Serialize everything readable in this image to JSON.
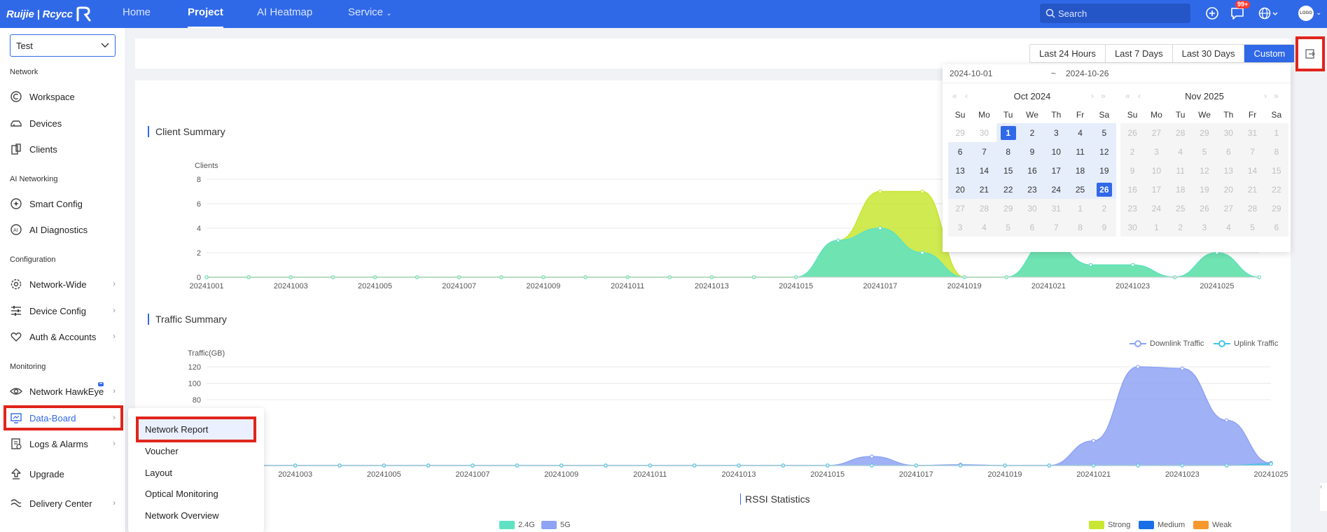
{
  "topbar": {
    "brand": "Ruijie | Rcycc",
    "nav": [
      "Home",
      "Project",
      "AI Heatmap",
      "Service"
    ],
    "active_nav": "Project",
    "search_placeholder": "Search",
    "notification_count": "99+",
    "avatar_text": "LOGO"
  },
  "sidebar": {
    "project": "Test",
    "sections": {
      "network": "Network",
      "ai": "AI Networking",
      "config": "Configuration",
      "monitoring": "Monitoring"
    },
    "items": {
      "workspace": "Workspace",
      "devices": "Devices",
      "clients": "Clients",
      "smart_config": "Smart Config",
      "ai_diagnostics": "AI Diagnostics",
      "network_wide": "Network-Wide",
      "device_config": "Device Config",
      "auth_accounts": "Auth & Accounts",
      "network_hawkeye": "Network HawkEye",
      "data_board": "Data-Board",
      "logs_alarms": "Logs & Alarms",
      "upgrade": "Upgrade",
      "delivery_center": "Delivery Center"
    },
    "active": "Data-Board"
  },
  "flyout": [
    "Network Report",
    "Voucher",
    "Layout",
    "Optical Monitoring",
    "Network Overview"
  ],
  "filter": {
    "ranges": [
      "Last 24 Hours",
      "Last 7 Days",
      "Last 30 Days",
      "Custom"
    ],
    "active_range": "Custom",
    "start_date": "2024-10-01",
    "separator": "~",
    "end_date": "2024-10-26"
  },
  "calendar": {
    "left": {
      "title": "Oct 2024",
      "weekdays": [
        "Su",
        "Mo",
        "Tu",
        "We",
        "Th",
        "Fr",
        "Sa"
      ],
      "days": [
        "29",
        "30",
        "1",
        "2",
        "3",
        "4",
        "5",
        "6",
        "7",
        "8",
        "9",
        "10",
        "11",
        "12",
        "13",
        "14",
        "15",
        "16",
        "17",
        "18",
        "19",
        "20",
        "21",
        "22",
        "23",
        "24",
        "25",
        "26",
        "27",
        "28",
        "29",
        "30",
        "31",
        "1",
        "2",
        "3",
        "4",
        "5",
        "6",
        "7",
        "8",
        "9"
      ],
      "first_in_month": 2,
      "last_in_month": 32,
      "selected": [
        "1",
        "26"
      ],
      "range_end_index": 27
    },
    "right": {
      "title": "Nov 2025",
      "weekdays": [
        "Su",
        "Mo",
        "Tu",
        "We",
        "Th",
        "Fr",
        "Sa"
      ],
      "days": [
        "26",
        "27",
        "28",
        "29",
        "30",
        "31",
        "1",
        "2",
        "3",
        "4",
        "5",
        "6",
        "7",
        "8",
        "9",
        "10",
        "11",
        "12",
        "13",
        "14",
        "15",
        "16",
        "17",
        "18",
        "19",
        "20",
        "21",
        "22",
        "23",
        "24",
        "25",
        "26",
        "27",
        "28",
        "29",
        "30",
        "1",
        "2",
        "3",
        "4",
        "5",
        "6"
      ]
    }
  },
  "client_summary": {
    "title": "Client Summary",
    "colors": {
      "2.4G": "#5ee2c3",
      "5G": "#c8e632"
    },
    "chart_data": {
      "type": "area",
      "ylabel": "Clients",
      "ylim": [
        0,
        8
      ],
      "yticks": [
        "0",
        "2",
        "4",
        "6",
        "8"
      ],
      "x": [
        "20241001",
        "20241002",
        "20241003",
        "20241004",
        "20241005",
        "20241006",
        "20241007",
        "20241008",
        "20241009",
        "20241010",
        "20241011",
        "20241012",
        "20241013",
        "20241014",
        "20241015",
        "20241016",
        "20241017",
        "20241018",
        "20241019",
        "20241020",
        "20241021",
        "20241022",
        "20241023",
        "20241024",
        "20241025",
        "20241026"
      ],
      "xticks": [
        "20241001",
        "20241003",
        "20241005",
        "20241007",
        "20241009",
        "20241011",
        "20241013",
        "20241015",
        "20241017",
        "20241019",
        "20241021",
        "20241023",
        "20241025"
      ],
      "series": [
        {
          "name": "2.4G",
          "values": [
            0,
            0,
            0,
            0,
            0,
            0,
            0,
            0,
            0,
            0,
            0,
            0,
            0,
            0,
            0,
            3,
            4,
            2,
            0,
            0,
            3,
            1,
            1,
            0,
            2,
            0
          ]
        },
        {
          "name": "5G",
          "values": [
            0,
            0,
            0,
            0,
            0,
            0,
            0,
            0,
            0,
            0,
            0,
            0,
            0,
            0,
            0,
            3,
            7,
            7,
            0,
            0,
            3,
            1,
            1,
            0,
            2,
            0
          ]
        }
      ]
    }
  },
  "traffic_summary": {
    "title": "Traffic Summary",
    "legend": [
      "Downlink Traffic",
      "Uplink Traffic"
    ],
    "colors": {
      "Downlink Traffic": "#8fa3f5",
      "Uplink Traffic": "#44c5e6"
    },
    "chart_data": {
      "type": "area",
      "ylabel": "Traffic(GB)",
      "ylim": [
        0,
        120
      ],
      "yticks": [
        "80",
        "100",
        "120"
      ],
      "x": [
        "20241001",
        "20241002",
        "20241003",
        "20241004",
        "20241005",
        "20241006",
        "20241007",
        "20241008",
        "20241009",
        "20241010",
        "20241011",
        "20241012",
        "20241013",
        "20241014",
        "20241015",
        "20241016",
        "20241017",
        "20241018",
        "20241019",
        "20241020",
        "20241021",
        "20241022",
        "20241023",
        "20241024",
        "20241025"
      ],
      "xticks": [
        "20241003",
        "20241005",
        "20241007",
        "20241009",
        "20241011",
        "20241013",
        "20241015",
        "20241017",
        "20241019",
        "20241021",
        "20241023",
        "20241025"
      ],
      "series": [
        {
          "name": "Downlink Traffic",
          "values": [
            0,
            0,
            0,
            0,
            0,
            0,
            0,
            0,
            0,
            0,
            0,
            0,
            0,
            0,
            0,
            11,
            0,
            1,
            0,
            0,
            30,
            120,
            118,
            55,
            3
          ]
        },
        {
          "name": "Uplink Traffic",
          "values": [
            0,
            0,
            0,
            0,
            0,
            0,
            0,
            0,
            0,
            0,
            0,
            0,
            0,
            0,
            0,
            0,
            0,
            0,
            0,
            0,
            0,
            0,
            0,
            0,
            2
          ]
        }
      ]
    }
  },
  "rssi": {
    "title": "RSSI Statistics",
    "band_legend": [
      "2.4G",
      "5G"
    ],
    "band_colors": [
      "#5ee2c3",
      "#8fa3f5"
    ],
    "strength_legend": [
      "Strong",
      "Medium",
      "Weak"
    ],
    "strength_colors": [
      "#c8e632",
      "#1a6fe8",
      "#f7972c"
    ]
  }
}
